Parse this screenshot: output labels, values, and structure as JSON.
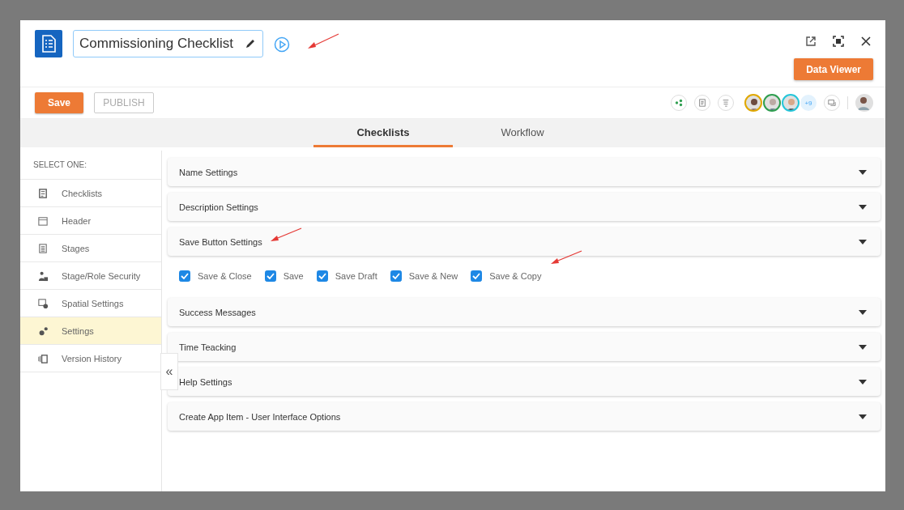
{
  "window": {
    "title": "Commissioning Checklist",
    "data_viewer_button": "Data Viewer"
  },
  "toolbar": {
    "save": "Save",
    "publish": "PUBLISH",
    "collaborators_more": "+9"
  },
  "tabs": [
    {
      "label": "Checklists",
      "selected": true
    },
    {
      "label": "Workflow",
      "selected": false
    }
  ],
  "sidebar": {
    "heading": "SELECT ONE:",
    "items": [
      {
        "label": "Checklists",
        "selected": false
      },
      {
        "label": "Header",
        "selected": false
      },
      {
        "label": "Stages",
        "selected": false
      },
      {
        "label": "Stage/Role Security",
        "selected": false
      },
      {
        "label": "Spatial Settings",
        "selected": false
      },
      {
        "label": "Settings",
        "selected": true
      },
      {
        "label": "Version History",
        "selected": false
      }
    ],
    "collapse": "«"
  },
  "sections": [
    {
      "title": "Name Settings"
    },
    {
      "title": "Description Settings"
    },
    {
      "title": "Save Button Settings",
      "options": [
        {
          "label": "Save & Close",
          "checked": true
        },
        {
          "label": "Save",
          "checked": true
        },
        {
          "label": "Save Draft",
          "checked": true
        },
        {
          "label": "Save & New",
          "checked": true
        },
        {
          "label": "Save & Copy",
          "checked": true
        }
      ]
    },
    {
      "title": "Success Messages"
    },
    {
      "title": "Time Teacking"
    },
    {
      "title": "Help Settings"
    },
    {
      "title": "Create App Item - User Interface Options"
    }
  ]
}
